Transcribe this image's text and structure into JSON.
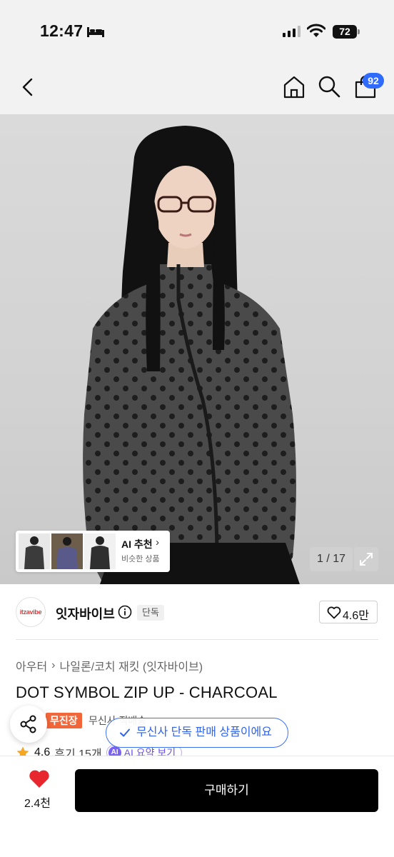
{
  "status_bar": {
    "time": "12:47",
    "battery": "72"
  },
  "header": {
    "cart_count": "92"
  },
  "hero": {
    "ai_recommend_title": "AI 추천",
    "ai_recommend_sub": "비슷한 상품",
    "pager": "1 / 17"
  },
  "brand": {
    "logo_text": "itzavibe",
    "name": "잇자바이브",
    "tag": "단독",
    "likes": "4.6만"
  },
  "product": {
    "breadcrumb": [
      "아우터",
      "나일론/코치 재킷 (잇자바이브)"
    ],
    "title": "DOT SYMBOL ZIP UP - CHARCOAL",
    "badge": "무진장",
    "delivery": "무신사 직배송",
    "exclusive_toast": "무신사 단독 판매 상품이에요",
    "rating": "4.6",
    "reviews": "후기 15개",
    "ai_summary_icon": "AI",
    "ai_summary": "AI 요약 보기"
  },
  "bottom": {
    "wish_count": "2.4천",
    "buy_label": "구매하기"
  },
  "colors": {
    "accent_blue": "#2f6bff",
    "badge_orange": "#f2673a",
    "ai_purple": "#7b63f0",
    "heart_red": "#e8262d"
  },
  "icons": [
    "back-icon",
    "home-icon",
    "search-icon",
    "cart-icon",
    "expand-icon",
    "info-icon",
    "heart-icon",
    "share-icon",
    "check-icon",
    "star-icon"
  ]
}
